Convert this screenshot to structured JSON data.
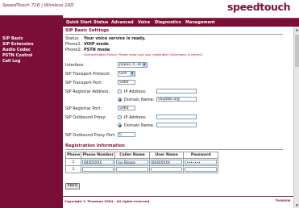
{
  "header": {
    "title": "SpeedTouch 716 | Wireless 16D",
    "logo": "speedtouch"
  },
  "nav": {
    "items": [
      "Quick Start",
      "Status",
      "Advanced",
      "Voice",
      "Diagnostics",
      "Management"
    ]
  },
  "sidebar": {
    "items": [
      "SIP Basic",
      "SIP Extension",
      "Audio Codec",
      "PSTN Control",
      "Call Log"
    ]
  },
  "sip_basic": {
    "section_title": "SIP Basic Settings",
    "status_label": "Status:",
    "status_value": "Your voice service is ready.",
    "phone1_label": "Phone1:",
    "phone1_value": "VOIP mode",
    "phone2_label": "Phone2:",
    "phone2_value": "PSTN mode",
    "phone2_note": "(Authentication Failure: Please make sure your registration information is correct.)",
    "interface_label": "Interface:",
    "interface_value": "pppoe_0_38",
    "transport_protocol_label": "SIP Transport Protocol:",
    "transport_protocol_value": "UDP",
    "transport_port_label": "SIP Transport Port:",
    "transport_port_value": "5060",
    "registrar_address_label": "SIP Registrar Address:",
    "ip_address_label": "IP Address:",
    "ip_address_value": "",
    "domain_name_label": "Domain Name:",
    "domain_name_value": "voiptalk.org",
    "registrar_port_label": "SIP Registrar Port:",
    "registrar_port_value": "5060",
    "outbound_proxy_label": "SIP Outbound Proxy:",
    "outbound_ip_label": "IP Address:",
    "outbound_ip_value": "",
    "outbound_domain_label": "Domain Name:",
    "outbound_domain_value": "",
    "outbound_port_label": "SIP Outbound Proxy Port:",
    "outbound_port_value": "0"
  },
  "registration": {
    "section_title": "Registration Information",
    "columns": [
      "Phone",
      "Phone Number",
      "Caller Name",
      "User Name",
      "Password"
    ],
    "rows": [
      {
        "phone": "1",
        "number": "8440XXXX",
        "caller": "Joe Bloggs",
        "user": "8440XXXX",
        "password": "•••••••"
      },
      {
        "phone": "2",
        "number": "",
        "caller": "",
        "user": "",
        "password": ""
      }
    ]
  },
  "apply_label": "Apply",
  "footer": {
    "copyright": "Copyright © Thomson 2004 - All rights reserved",
    "logo": "THOMSON"
  },
  "colors": {
    "brand": "#7a0e36",
    "warning": "#c4001a"
  }
}
